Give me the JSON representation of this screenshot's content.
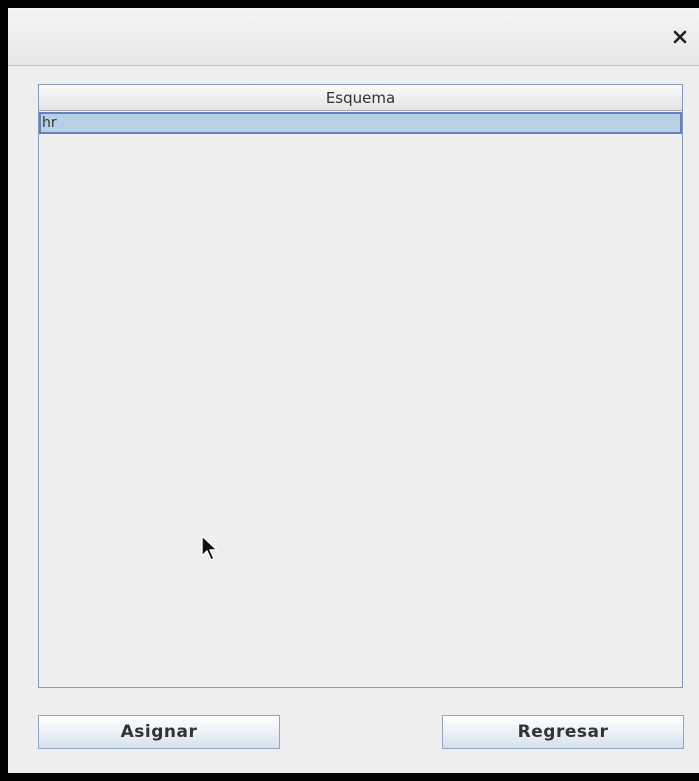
{
  "dialog": {
    "title": "",
    "close_icon": "close-icon"
  },
  "table": {
    "columns": [
      "Esquema"
    ],
    "rows": [
      {
        "esquema": "hr",
        "selected": true
      }
    ]
  },
  "buttons": {
    "assign_label": "Asignar",
    "back_label": "Regresar"
  },
  "colors": {
    "selection_fill": "#b8cfe5",
    "selection_border": "#6382bf",
    "window_bg": "#eeeeee"
  }
}
